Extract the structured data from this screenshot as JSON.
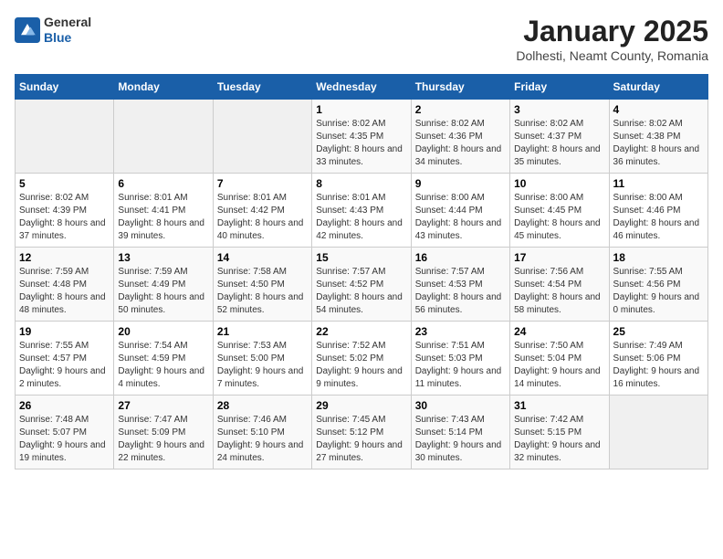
{
  "logo": {
    "line1": "General",
    "line2": "Blue"
  },
  "title": "January 2025",
  "subtitle": "Dolhesti, Neamt County, Romania",
  "headers": [
    "Sunday",
    "Monday",
    "Tuesday",
    "Wednesday",
    "Thursday",
    "Friday",
    "Saturday"
  ],
  "weeks": [
    [
      {
        "day": "",
        "info": ""
      },
      {
        "day": "",
        "info": ""
      },
      {
        "day": "",
        "info": ""
      },
      {
        "day": "1",
        "info": "Sunrise: 8:02 AM\nSunset: 4:35 PM\nDaylight: 8 hours and 33 minutes."
      },
      {
        "day": "2",
        "info": "Sunrise: 8:02 AM\nSunset: 4:36 PM\nDaylight: 8 hours and 34 minutes."
      },
      {
        "day": "3",
        "info": "Sunrise: 8:02 AM\nSunset: 4:37 PM\nDaylight: 8 hours and 35 minutes."
      },
      {
        "day": "4",
        "info": "Sunrise: 8:02 AM\nSunset: 4:38 PM\nDaylight: 8 hours and 36 minutes."
      }
    ],
    [
      {
        "day": "5",
        "info": "Sunrise: 8:02 AM\nSunset: 4:39 PM\nDaylight: 8 hours and 37 minutes."
      },
      {
        "day": "6",
        "info": "Sunrise: 8:01 AM\nSunset: 4:41 PM\nDaylight: 8 hours and 39 minutes."
      },
      {
        "day": "7",
        "info": "Sunrise: 8:01 AM\nSunset: 4:42 PM\nDaylight: 8 hours and 40 minutes."
      },
      {
        "day": "8",
        "info": "Sunrise: 8:01 AM\nSunset: 4:43 PM\nDaylight: 8 hours and 42 minutes."
      },
      {
        "day": "9",
        "info": "Sunrise: 8:00 AM\nSunset: 4:44 PM\nDaylight: 8 hours and 43 minutes."
      },
      {
        "day": "10",
        "info": "Sunrise: 8:00 AM\nSunset: 4:45 PM\nDaylight: 8 hours and 45 minutes."
      },
      {
        "day": "11",
        "info": "Sunrise: 8:00 AM\nSunset: 4:46 PM\nDaylight: 8 hours and 46 minutes."
      }
    ],
    [
      {
        "day": "12",
        "info": "Sunrise: 7:59 AM\nSunset: 4:48 PM\nDaylight: 8 hours and 48 minutes."
      },
      {
        "day": "13",
        "info": "Sunrise: 7:59 AM\nSunset: 4:49 PM\nDaylight: 8 hours and 50 minutes."
      },
      {
        "day": "14",
        "info": "Sunrise: 7:58 AM\nSunset: 4:50 PM\nDaylight: 8 hours and 52 minutes."
      },
      {
        "day": "15",
        "info": "Sunrise: 7:57 AM\nSunset: 4:52 PM\nDaylight: 8 hours and 54 minutes."
      },
      {
        "day": "16",
        "info": "Sunrise: 7:57 AM\nSunset: 4:53 PM\nDaylight: 8 hours and 56 minutes."
      },
      {
        "day": "17",
        "info": "Sunrise: 7:56 AM\nSunset: 4:54 PM\nDaylight: 8 hours and 58 minutes."
      },
      {
        "day": "18",
        "info": "Sunrise: 7:55 AM\nSunset: 4:56 PM\nDaylight: 9 hours and 0 minutes."
      }
    ],
    [
      {
        "day": "19",
        "info": "Sunrise: 7:55 AM\nSunset: 4:57 PM\nDaylight: 9 hours and 2 minutes."
      },
      {
        "day": "20",
        "info": "Sunrise: 7:54 AM\nSunset: 4:59 PM\nDaylight: 9 hours and 4 minutes."
      },
      {
        "day": "21",
        "info": "Sunrise: 7:53 AM\nSunset: 5:00 PM\nDaylight: 9 hours and 7 minutes."
      },
      {
        "day": "22",
        "info": "Sunrise: 7:52 AM\nSunset: 5:02 PM\nDaylight: 9 hours and 9 minutes."
      },
      {
        "day": "23",
        "info": "Sunrise: 7:51 AM\nSunset: 5:03 PM\nDaylight: 9 hours and 11 minutes."
      },
      {
        "day": "24",
        "info": "Sunrise: 7:50 AM\nSunset: 5:04 PM\nDaylight: 9 hours and 14 minutes."
      },
      {
        "day": "25",
        "info": "Sunrise: 7:49 AM\nSunset: 5:06 PM\nDaylight: 9 hours and 16 minutes."
      }
    ],
    [
      {
        "day": "26",
        "info": "Sunrise: 7:48 AM\nSunset: 5:07 PM\nDaylight: 9 hours and 19 minutes."
      },
      {
        "day": "27",
        "info": "Sunrise: 7:47 AM\nSunset: 5:09 PM\nDaylight: 9 hours and 22 minutes."
      },
      {
        "day": "28",
        "info": "Sunrise: 7:46 AM\nSunset: 5:10 PM\nDaylight: 9 hours and 24 minutes."
      },
      {
        "day": "29",
        "info": "Sunrise: 7:45 AM\nSunset: 5:12 PM\nDaylight: 9 hours and 27 minutes."
      },
      {
        "day": "30",
        "info": "Sunrise: 7:43 AM\nSunset: 5:14 PM\nDaylight: 9 hours and 30 minutes."
      },
      {
        "day": "31",
        "info": "Sunrise: 7:42 AM\nSunset: 5:15 PM\nDaylight: 9 hours and 32 minutes."
      },
      {
        "day": "",
        "info": ""
      }
    ]
  ]
}
